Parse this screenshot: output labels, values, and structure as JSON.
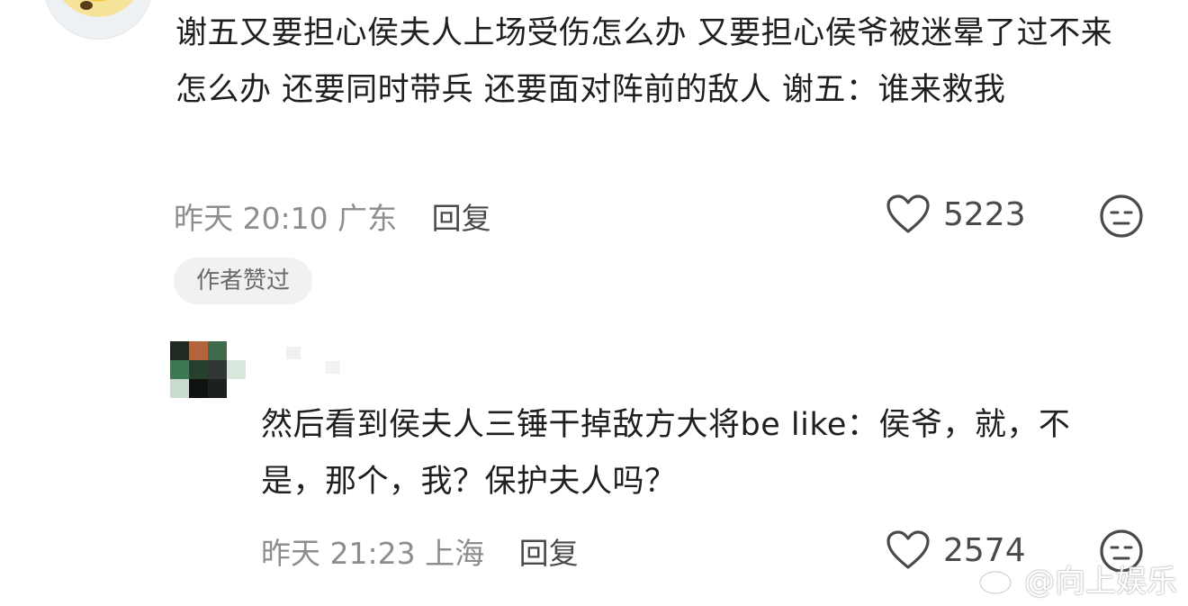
{
  "comments": [
    {
      "text": "谢五又要担心侯夫人上场受伤怎么办 又要担心侯爷被迷晕了过不来怎么办 还要同时带兵 还要面对阵前的敌人 谢五：谁来救我",
      "time": "昨天 20:10",
      "location": "广东",
      "reply_label": "回复",
      "likes": "5223",
      "badge": "作者赞过"
    },
    {
      "text": "然后看到侯夫人三锤干掉敌方大将be like：侯爷，就，不是，那个，我？保护夫人吗？",
      "time": "昨天 21:23",
      "location": "上海",
      "reply_label": "回复",
      "likes": "2574"
    }
  ],
  "watermark": "@向上娱乐",
  "icons": {
    "like": "heart-outline-icon",
    "reaction": "meh-face-icon",
    "watermark": "weibo-logo-icon"
  },
  "colors": {
    "text": "#1f1f1f",
    "meta": "#8d8d8d",
    "badge_bg": "#f1f1f1"
  }
}
